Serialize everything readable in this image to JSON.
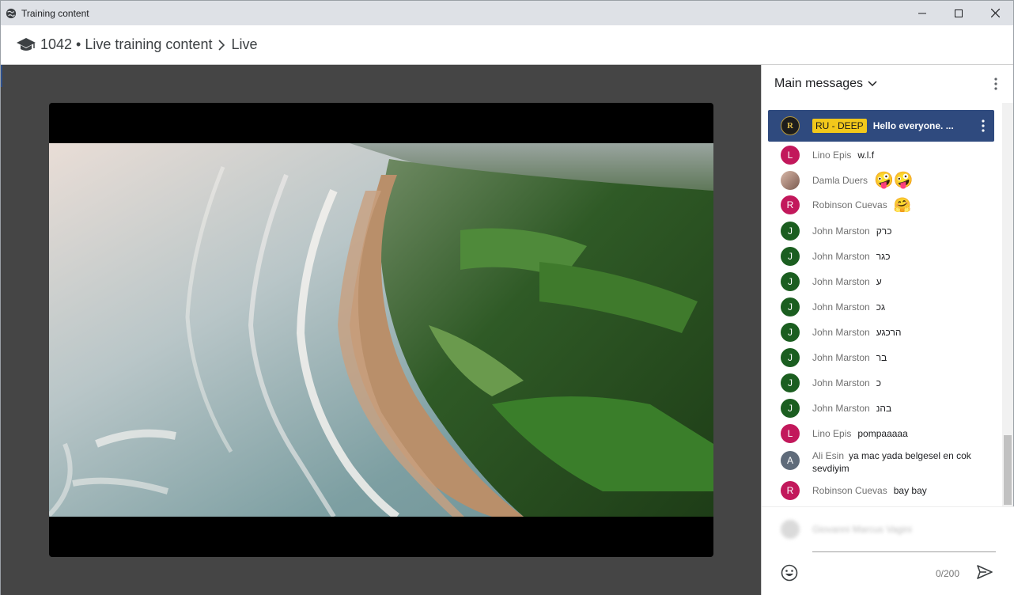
{
  "window": {
    "title": "Training content"
  },
  "breadcrumb": {
    "course": "1042 • Live training content",
    "current": "Live"
  },
  "chat": {
    "title": "Main messages",
    "pinned": {
      "tag": "RU - DEEP",
      "message": "Hello everyone. ...",
      "logo_letter": "R"
    },
    "messages": [
      {
        "initial": "L",
        "color": "#c2185b",
        "author": "Lino Epis",
        "text": "w.l.f"
      },
      {
        "initial": "",
        "color": "#b08878",
        "author": "Damla Duers",
        "text": "🤪🤪"
      },
      {
        "initial": "R",
        "color": "#c2185b",
        "author": "Robinson Cuevas",
        "text": "🤗"
      },
      {
        "initial": "J",
        "color": "#1b5e20",
        "author": "John Marston",
        "text": "כרק"
      },
      {
        "initial": "J",
        "color": "#1b5e20",
        "author": "John Marston",
        "text": "כגר"
      },
      {
        "initial": "J",
        "color": "#1b5e20",
        "author": "John Marston",
        "text": "ע"
      },
      {
        "initial": "J",
        "color": "#1b5e20",
        "author": "John Marston",
        "text": "גכ"
      },
      {
        "initial": "J",
        "color": "#1b5e20",
        "author": "John Marston",
        "text": "הרכגע"
      },
      {
        "initial": "J",
        "color": "#1b5e20",
        "author": "John Marston",
        "text": "בר"
      },
      {
        "initial": "J",
        "color": "#1b5e20",
        "author": "John Marston",
        "text": "כ"
      },
      {
        "initial": "J",
        "color": "#1b5e20",
        "author": "John Marston",
        "text": "בהנ"
      },
      {
        "initial": "L",
        "color": "#c2185b",
        "author": "Lino Epis",
        "text": "pompaaaaa"
      },
      {
        "initial": "A",
        "color": "#5f6b7a",
        "author": "Ali Esin",
        "text": "ya mac yada belgesel en cok sevdiyim"
      },
      {
        "initial": "R",
        "color": "#c2185b",
        "author": "Robinson Cuevas",
        "text": "bay bay"
      }
    ],
    "composer": {
      "user": "Giovanni Marcus Vagini",
      "counter": "0/200"
    }
  }
}
